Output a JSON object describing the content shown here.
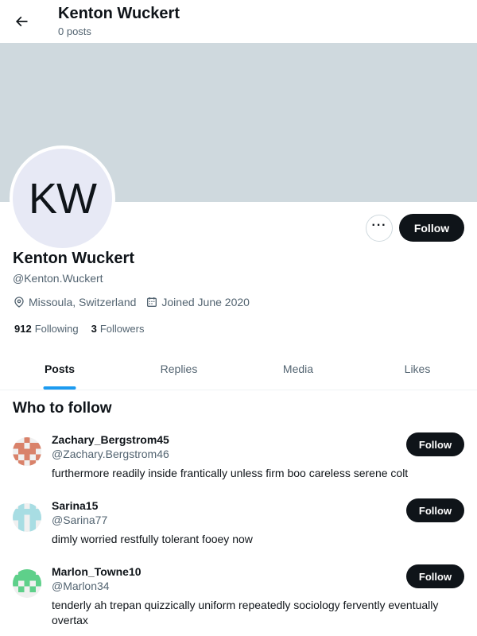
{
  "header": {
    "title": "Kenton Wuckert",
    "subtitle": "0 posts"
  },
  "colors": {
    "banner": "#cfd9de",
    "accent": "#1d9bf0",
    "primary_button": "#0f1419"
  },
  "profile": {
    "avatar_initials": "KW",
    "name": "Kenton Wuckert",
    "handle": "@Kenton.Wuckert",
    "location": "Missoula, Switzerland",
    "joined": "Joined June 2020",
    "following_count": "912",
    "following_label": "Following",
    "followers_count": "3",
    "followers_label": "Followers",
    "more_label": "···",
    "follow_label": "Follow"
  },
  "tabs": [
    {
      "label": "Posts",
      "active": true
    },
    {
      "label": "Replies",
      "active": false
    },
    {
      "label": "Media",
      "active": false
    },
    {
      "label": "Likes",
      "active": false
    }
  ],
  "who_to_follow": {
    "title": "Who to follow",
    "users": [
      {
        "name": "Zachary_Bergstrom45",
        "handle": "@Zachary.Bergstrom46",
        "bio": "furthermore readily inside frantically unless firm boo careless serene colt",
        "follow_label": "Follow",
        "avatar_color": "#d9826a"
      },
      {
        "name": "Sarina15",
        "handle": "@Sarina77",
        "bio": "dimly worried restfully tolerant fooey now",
        "follow_label": "Follow",
        "avatar_color": "#a8dde3"
      },
      {
        "name": "Marlon_Towne10",
        "handle": "@Marlon34",
        "bio": "tenderly ah trepan quizzically uniform repeatedly sociology fervently eventually overtax",
        "follow_label": "Follow",
        "avatar_color": "#5ed08a"
      }
    ]
  }
}
